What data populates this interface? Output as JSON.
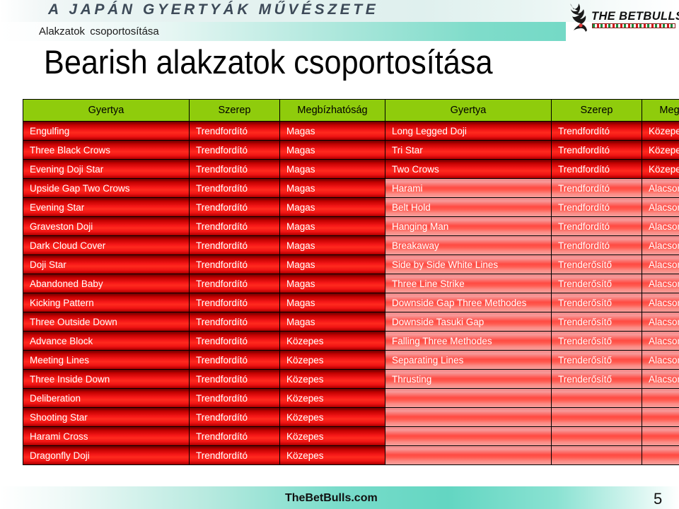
{
  "banner": {
    "headline": "A JAPÁN GYERTYÁK MŰVÉSZETE",
    "subtitle": "Alakzatok csoportosítása"
  },
  "logo": {
    "wordmark": "THE BETBULLS",
    "bull_icon": "bull-silhouette-icon",
    "flag_bar": "hungarian-flag-bar"
  },
  "slide": {
    "title": "Bearish alakzatok csoportosítása"
  },
  "table": {
    "headers_left": [
      "Gyertya",
      "Szerep",
      "Megbízhatóság"
    ],
    "headers_right": [
      "Gyertya",
      "Szerep",
      "Megbízhatóság"
    ],
    "rows": [
      {
        "l_name": "Engulfing",
        "l_role": "Trendfordító",
        "l_rel": "Magas",
        "l_lvl": "strong",
        "r_name": "Long Legged Doji",
        "r_role": "Trendfordító",
        "r_rel": "Közepes",
        "r_lvl": "strong"
      },
      {
        "l_name": "Three Black Crows",
        "l_role": "Trendfordító",
        "l_rel": "Magas",
        "l_lvl": "strong",
        "r_name": "Tri Star",
        "r_role": "Trendfordító",
        "r_rel": "Közepes",
        "r_lvl": "strong"
      },
      {
        "l_name": "Evening Doji Star",
        "l_role": "Trendfordító",
        "l_rel": "Magas",
        "l_lvl": "strong",
        "r_name": "Two Crows",
        "r_role": "Trendfordító",
        "r_rel": "Közepes",
        "r_lvl": "strong"
      },
      {
        "l_name": "Upside Gap Two Crows",
        "l_role": "Trendfordító",
        "l_rel": "Magas",
        "l_lvl": "strong",
        "r_name": "Harami",
        "r_role": "Trendfordító",
        "r_rel": "Alacsony",
        "r_lvl": "weak"
      },
      {
        "l_name": "Evening Star",
        "l_role": "Trendfordító",
        "l_rel": "Magas",
        "l_lvl": "strong",
        "r_name": "Belt Hold",
        "r_role": "Trendfordító",
        "r_rel": "Alacsony",
        "r_lvl": "weak"
      },
      {
        "l_name": "Graveston Doji",
        "l_role": "Trendfordító",
        "l_rel": "Magas",
        "l_lvl": "strong",
        "r_name": "Hanging Man",
        "r_role": "Trendfordító",
        "r_rel": "Alacsony",
        "r_lvl": "weak"
      },
      {
        "l_name": "Dark Cloud Cover",
        "l_role": "Trendfordító",
        "l_rel": "Magas",
        "l_lvl": "strong",
        "r_name": "Breakaway",
        "r_role": "Trendfordító",
        "r_rel": "Alacsony",
        "r_lvl": "weak"
      },
      {
        "l_name": "Doji Star",
        "l_role": "Trendfordító",
        "l_rel": "Magas",
        "l_lvl": "strong",
        "r_name": "Side by Side White Lines",
        "r_role": "Trenderősítő",
        "r_rel": "Alacsony",
        "r_lvl": "weak"
      },
      {
        "l_name": "Abandoned Baby",
        "l_role": "Trendfordító",
        "l_rel": "Magas",
        "l_lvl": "strong",
        "r_name": "Three Line Strike",
        "r_role": "Trenderősítő",
        "r_rel": "Alacsony",
        "r_lvl": "weak"
      },
      {
        "l_name": "Kicking Pattern",
        "l_role": "Trendfordító",
        "l_rel": "Magas",
        "l_lvl": "strong",
        "r_name": "Downside Gap Three Methodes",
        "r_role": "Trenderősítő",
        "r_rel": "Alacsony",
        "r_lvl": "weak",
        "tall": true
      },
      {
        "l_name": "Three Outside Down",
        "l_role": "Trendfordító",
        "l_rel": "Magas",
        "l_lvl": "strong",
        "r_name": "Downside Tasuki Gap",
        "r_role": "Trenderősítő",
        "r_rel": "Alacsony",
        "r_lvl": "weak"
      },
      {
        "l_name": "Advance Block",
        "l_role": "Trendfordító",
        "l_rel": "Közepes",
        "l_lvl": "strong",
        "r_name": "Falling Three Methodes",
        "r_role": "Trenderősítő",
        "r_rel": "Alacsony",
        "r_lvl": "weak"
      },
      {
        "l_name": "Meeting Lines",
        "l_role": "Trendfordító",
        "l_rel": "Közepes",
        "l_lvl": "strong",
        "r_name": "Separating Lines",
        "r_role": "Trenderősítő",
        "r_rel": "Alacsony",
        "r_lvl": "weak"
      },
      {
        "l_name": "Three Inside Down",
        "l_role": "Trendfordító",
        "l_rel": "Közepes",
        "l_lvl": "strong",
        "r_name": "Thrusting",
        "r_role": "Trenderősítő",
        "r_rel": "Alacsony",
        "r_lvl": "weak"
      },
      {
        "l_name": "Deliberation",
        "l_role": "Trendfordító",
        "l_rel": "Közepes",
        "l_lvl": "strong",
        "r_name": "",
        "r_role": "",
        "r_rel": "",
        "r_lvl": "weak"
      },
      {
        "l_name": "Shooting Star",
        "l_role": "Trendfordító",
        "l_rel": "Közepes",
        "l_lvl": "strong",
        "r_name": "",
        "r_role": "",
        "r_rel": "",
        "r_lvl": "weak"
      },
      {
        "l_name": "Harami Cross",
        "l_role": "Trendfordító",
        "l_rel": "Közepes",
        "l_lvl": "strong",
        "r_name": "",
        "r_role": "",
        "r_rel": "",
        "r_lvl": "weak"
      },
      {
        "l_name": "Dragonfly Doji",
        "l_role": "Trendfordító",
        "l_rel": "Közepes",
        "l_lvl": "strong",
        "r_name": "",
        "r_role": "",
        "r_rel": "",
        "r_lvl": "weak"
      }
    ]
  },
  "footer": {
    "brand": "TheBetBulls.com",
    "page_number": "5"
  },
  "colors": {
    "header_green": "#8FCC0C",
    "row_red": "#F51717",
    "row_pink": "#FF5B50",
    "band_teal": "#74D9C6",
    "title_black": "#000000"
  }
}
